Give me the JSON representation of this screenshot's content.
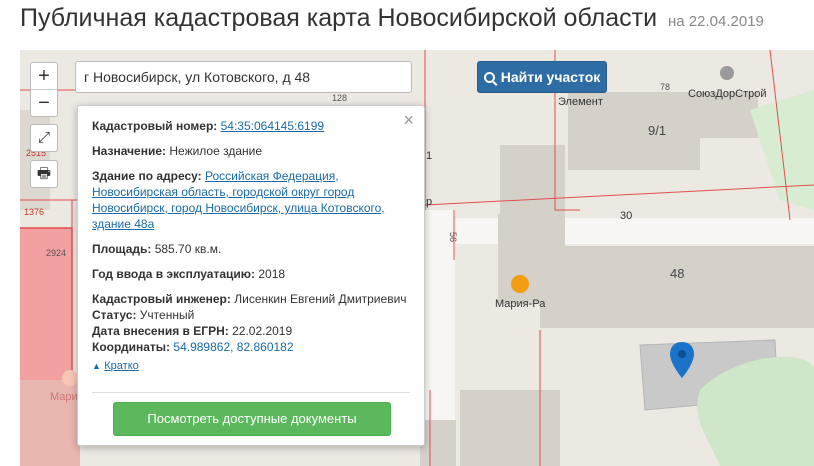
{
  "header": {
    "title": "Публичная кадастровая карта Новосибирской области",
    "date": "на 22.04.2019"
  },
  "map": {
    "zoom_in": "+",
    "zoom_out": "−",
    "expand_icon": "⤢",
    "print_icon": "🖶",
    "search_value": "г Новосибирск, ул Котовского, д 48",
    "find_button": "Найти участок",
    "labels": {
      "l2515": "2515",
      "l1376": "1376",
      "l2924": "2924",
      "l128": "128",
      "l78": "78",
      "l91": "9/1",
      "l30": "30",
      "l48": "48",
      "l56": "56",
      "lp": "р",
      "l1": "1",
      "element": "Элемент",
      "souzdor": "СоюзДорСтрой",
      "maria": "Мария-Ра",
      "maria_left": "Мари"
    }
  },
  "popup": {
    "close": "×",
    "cadnum_label": "Кадастровый номер:",
    "cadnum_value": "54:35:064145:6199",
    "purpose_label": "Назначение:",
    "purpose_value": "Нежилое здание",
    "address_label": "Здание по адресу:",
    "address_value": "Российская Федерация, Новосибирская область, городской округ город Новосибирск, город Новосибирск, улица Котовского, здание 48а",
    "area_label": "Площадь:",
    "area_value": "585.70 кв.м.",
    "year_label": "Год ввода в эксплуатацию:",
    "year_value": "2018",
    "engineer_label": "Кадастровый инженер:",
    "engineer_value": "Лисенкин Евгений Дмитриевич",
    "status_label": "Статус:",
    "status_value": "Учтенный",
    "egrn_label": "Дата внесения в ЕГРН:",
    "egrn_value": "22.02.2019",
    "coords_label": "Координаты:",
    "coords_value": "54.989862, 82.860182",
    "brief": "Кратко",
    "docs_button": "Посмотреть доступные документы"
  },
  "colors": {
    "accent": "#2e6da4",
    "green": "#5cb85c",
    "cadastre_red": "#e05050",
    "pin": "#1a73c8"
  }
}
